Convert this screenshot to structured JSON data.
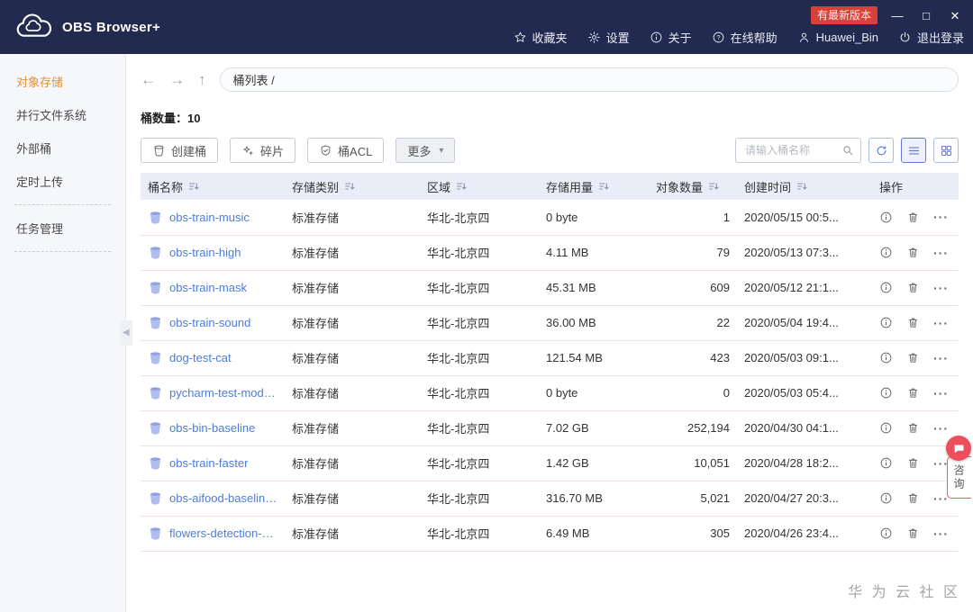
{
  "titlebar": {
    "app_name": "OBS Browser+",
    "update_badge": "有最新版本",
    "window_controls": {
      "minimize": "—",
      "maximize": "□",
      "close": "✕"
    },
    "menu": [
      {
        "id": "favorites",
        "icon": "star",
        "label": "收藏夹"
      },
      {
        "id": "settings",
        "icon": "gear",
        "label": "设置"
      },
      {
        "id": "about",
        "icon": "info",
        "label": "关于"
      },
      {
        "id": "help",
        "icon": "help",
        "label": "在线帮助"
      },
      {
        "id": "account",
        "icon": "user",
        "label": "Huawei_Bin"
      },
      {
        "id": "logout",
        "icon": "power",
        "label": "退出登录"
      }
    ]
  },
  "sidebar": {
    "items": [
      {
        "id": "object-storage",
        "label": "对象存储",
        "active": true,
        "divider_after": false
      },
      {
        "id": "parallel-file-system",
        "label": "并行文件系统",
        "active": false,
        "divider_after": false
      },
      {
        "id": "external-bucket",
        "label": "外部桶",
        "active": false,
        "divider_after": false
      },
      {
        "id": "scheduled-upload",
        "label": "定时上传",
        "active": false,
        "divider_after": true
      },
      {
        "id": "task-management",
        "label": "任务管理",
        "active": false,
        "divider_after": true
      }
    ]
  },
  "nav": {
    "breadcrumb": "桶列表 /"
  },
  "content": {
    "bucket_count": "桶数量：10",
    "toolbar": {
      "create_bucket": "创建桶",
      "fragments": "碎片",
      "bucket_acl": "桶ACL",
      "more": "更多",
      "search_placeholder": "请输入桶名称"
    },
    "table": {
      "columns": [
        "桶名称",
        "存储类别",
        "区域",
        "存储用量",
        "对象数量",
        "创建时间",
        "操作"
      ],
      "rows": [
        {
          "name": "obs-train-music",
          "storage_class": "标准存储",
          "region": "华北-北京四",
          "usage": "0 byte",
          "objects": "1",
          "created": "2020/05/15 00:5..."
        },
        {
          "name": "obs-train-high",
          "storage_class": "标准存储",
          "region": "华北-北京四",
          "usage": "4.11 MB",
          "objects": "79",
          "created": "2020/05/13 07:3..."
        },
        {
          "name": "obs-train-mask",
          "storage_class": "标准存储",
          "region": "华北-北京四",
          "usage": "45.31 MB",
          "objects": "609",
          "created": "2020/05/12 21:1..."
        },
        {
          "name": "obs-train-sound",
          "storage_class": "标准存储",
          "region": "华北-北京四",
          "usage": "36.00 MB",
          "objects": "22",
          "created": "2020/05/04 19:4..."
        },
        {
          "name": "dog-test-cat",
          "storage_class": "标准存储",
          "region": "华北-北京四",
          "usage": "121.54 MB",
          "objects": "423",
          "created": "2020/05/03 09:1..."
        },
        {
          "name": "pycharm-test-model...",
          "storage_class": "标准存储",
          "region": "华北-北京四",
          "usage": "0 byte",
          "objects": "0",
          "created": "2020/05/03 05:4..."
        },
        {
          "name": "obs-bin-baseline",
          "storage_class": "标准存储",
          "region": "华北-北京四",
          "usage": "7.02 GB",
          "objects": "252,194",
          "created": "2020/04/30 04:1..."
        },
        {
          "name": "obs-train-faster",
          "storage_class": "标准存储",
          "region": "华北-北京四",
          "usage": "1.42 GB",
          "objects": "10,051",
          "created": "2020/04/28 18:2..."
        },
        {
          "name": "obs-aifood-baseline-...",
          "storage_class": "标准存储",
          "region": "华北-北京四",
          "usage": "316.70 MB",
          "objects": "5,021",
          "created": "2020/04/27 20:3..."
        },
        {
          "name": "flowers-detection-obs",
          "storage_class": "标准存储",
          "region": "华北-北京四",
          "usage": "6.49 MB",
          "objects": "305",
          "created": "2020/04/26 23:4..."
        }
      ]
    }
  },
  "floating": {
    "consult": "咨询"
  },
  "watermark": "华 为 云 社 区",
  "colors": {
    "header_bg": "#232A4F",
    "accent_blue": "#5E7CE0",
    "link_blue": "#4D7DD6",
    "active_orange": "#E78F2B",
    "badge_red": "#D8403A",
    "consult_red": "#EE5A5A",
    "table_header_bg": "#E9EDF8",
    "row_border": "#F4E2E2"
  }
}
